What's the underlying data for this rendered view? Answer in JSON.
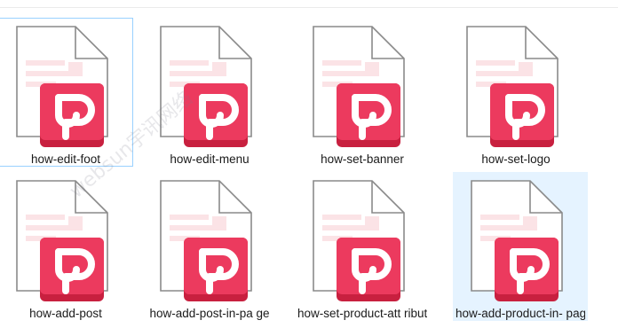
{
  "files": [
    {
      "name": "how-edit-foot",
      "icon": "pdf-file-icon"
    },
    {
      "name": "how-edit-menu",
      "icon": "pdf-file-icon"
    },
    {
      "name": "how-set-banner",
      "icon": "pdf-file-icon"
    },
    {
      "name": "how-set-logo",
      "icon": "pdf-file-icon"
    },
    {
      "name": "how-add-post",
      "icon": "pdf-file-icon"
    },
    {
      "name": "how-add-post-in-pa ge",
      "icon": "pdf-file-icon"
    },
    {
      "name": "how-set-product-att ribute",
      "icon": "pdf-file-icon"
    },
    {
      "name": "how-add-product-in- page",
      "icon": "pdf-file-icon"
    }
  ],
  "watermark": "websun宇讯网络",
  "colors": {
    "badge": "#e8335a",
    "badge_shadow": "#c8203f",
    "selection": "#e5f3ff",
    "focus_border": "#99d1ff"
  }
}
